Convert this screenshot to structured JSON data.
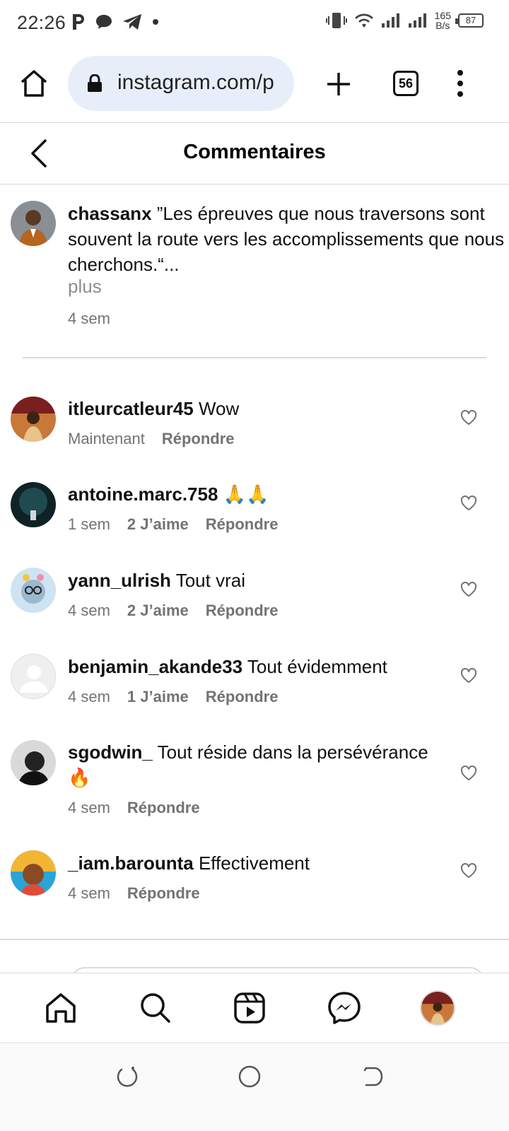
{
  "status_bar": {
    "time": "22:26",
    "net_speed_value": "165",
    "net_speed_unit": "B/s",
    "battery": "87"
  },
  "browser": {
    "url": "instagram.com/p",
    "tab_count": "56"
  },
  "header": {
    "title": "Commentaires"
  },
  "caption": {
    "username": "chassanx",
    "text": "”Les épreuves que nous traversons sont souvent la route vers les accomplissements que nous cherchons.“...",
    "more_label": "plus",
    "time": "4 sem"
  },
  "comments": [
    {
      "username": "itleurcatleur45",
      "text": "Wow",
      "time": "Maintenant",
      "likes": "",
      "reply_label": "Répondre"
    },
    {
      "username": "antoine.marc.758",
      "text": "🙏🙏",
      "time": "1 sem",
      "likes": "2 J’aime",
      "reply_label": "Répondre"
    },
    {
      "username": "yann_ulrish",
      "text": "Tout vrai",
      "time": "4 sem",
      "likes": "2 J’aime",
      "reply_label": "Répondre"
    },
    {
      "username": "benjamin_akande33",
      "text": "Tout évidemment",
      "time": "4 sem",
      "likes": "1 J’aime",
      "reply_label": "Répondre"
    },
    {
      "username": "sgodwin_",
      "text": "Tout réside dans la persévérance 🔥",
      "time": "4 sem",
      "likes": "",
      "reply_label": "Répondre"
    },
    {
      "username": "_iam.barounta",
      "text": "Effectivement",
      "time": "4 sem",
      "likes": "",
      "reply_label": "Répondre"
    }
  ],
  "colors": {
    "url_bar_bg": "#e8eef9",
    "secondary_text": "#737373",
    "divider": "#dbdbdb"
  }
}
